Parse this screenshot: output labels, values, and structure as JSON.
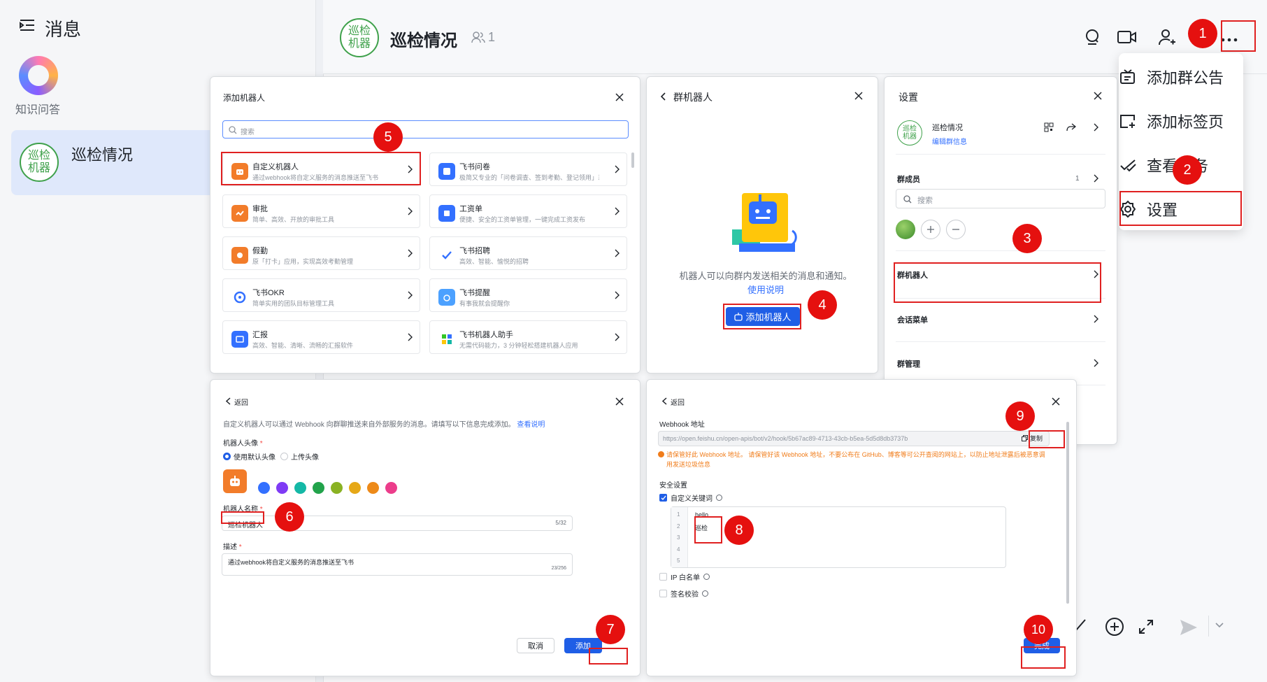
{
  "sidebar": {
    "title": "消息",
    "app_label": "知识问答",
    "conversation": {
      "name": "巡检情况",
      "avatar_text": "巡检机器"
    }
  },
  "header": {
    "avatar_text": "巡检机器",
    "title": "巡检情况",
    "member_count": "1"
  },
  "dropdown_menu": {
    "items": [
      {
        "label": "添加群公告",
        "icon": "announcement-icon"
      },
      {
        "label": "添加标签页",
        "icon": "add-tab-icon"
      },
      {
        "label": "查看任务",
        "icon": "task-check-icon"
      },
      {
        "label": "设置",
        "icon": "gear-icon"
      }
    ]
  },
  "add_robot_panel": {
    "title": "添加机器人",
    "search_placeholder": "搜索",
    "cards": [
      {
        "title": "自定义机器人",
        "desc": "通过webhook将自定义服务的消息推送至飞书",
        "color": "#f27c2a"
      },
      {
        "title": "飞书问卷",
        "desc": "极简又专业的「问卷调查、签到考勤、登记领用」系统",
        "color": "#3370ff"
      },
      {
        "title": "审批",
        "desc": "简单、高效、开放的审批工具",
        "color": "#f27c2a"
      },
      {
        "title": "工资单",
        "desc": "便捷、安全的工资单管理，一键完成工资发布",
        "color": "#3370ff"
      },
      {
        "title": "假勤",
        "desc": "原「打卡」应用，实现高效考勤管理",
        "color": "#f27c2a"
      },
      {
        "title": "飞书招聘",
        "desc": "高效、智能、愉悦的招聘",
        "color": "#3370ff"
      },
      {
        "title": "飞书OKR",
        "desc": "简单实用的团队目标管理工具",
        "color": "#3370ff"
      },
      {
        "title": "飞书提醒",
        "desc": "有事我就会提醒你",
        "color": "#4ca1ff"
      },
      {
        "title": "汇报",
        "desc": "高效、智能、清晰、流畅的汇报软件",
        "color": "#3370ff"
      },
      {
        "title": "飞书机器人助手",
        "desc": "无需代码能力，3 分钟轻松搭建机器人应用",
        "color": "#34c724"
      }
    ]
  },
  "group_robot_panel": {
    "title": "群机器人",
    "description": "机器人可以向群内发送相关的消息和通知。",
    "help_link": "使用说明",
    "add_button": "添加机器人"
  },
  "settings_panel": {
    "title": "设置",
    "group_name": "巡检情况",
    "edit_info": "编辑群信息",
    "members_label": "群成员",
    "members_count": "1",
    "search_placeholder": "搜索",
    "group_robot": "群机器人",
    "session_menu": "会话菜单",
    "group_manage": "群管理"
  },
  "custom_robot_form": {
    "back": "返回",
    "intro": "自定义机器人可以通过 Webhook 向群聊推送来自外部服务的消息。请填写以下信息完成添加。",
    "intro_link": "查看说明",
    "avatar_label": "机器人头像",
    "avatar_default": "使用默认头像",
    "avatar_upload": "上传头像",
    "avatar_colors": [
      "#3370ff",
      "#7f3bf5",
      "#14b8a6",
      "#22a34b",
      "#8ab223",
      "#e6a817",
      "#ed8a19",
      "#ec3d8b"
    ],
    "name_label": "机器人名称",
    "name_value": "巡检机器人",
    "name_counter": "5/32",
    "desc_label": "描述",
    "desc_value": "通过webhook将自定义服务的消息推送至飞书",
    "desc_counter": "23/256",
    "cancel": "取消",
    "add": "添加"
  },
  "webhook_panel": {
    "back": "返回",
    "webhook_label": "Webhook 地址",
    "webhook_url": "https://open.feishu.cn/open-apis/bot/v2/hook/5b67ac89-4713-43cb-b5ea-5d5d8db3737b",
    "copy": "复制",
    "warning": "请保管好此 Webhook 地址。 请保管好该 Webhook 地址，不要公布在 GitHub、博客等可公开查阅的网站上，以防止地址泄露后被恶意调用发送垃圾信息",
    "security_label": "安全设置",
    "keyword_label": "自定义关键词",
    "keywords": [
      "hello",
      "巡检",
      "",
      "",
      ""
    ],
    "ip_whitelist": "IP 白名单",
    "signature": "签名校验",
    "done": "完成"
  },
  "steps": [
    "1",
    "2",
    "3",
    "4",
    "5",
    "6",
    "7",
    "8",
    "9",
    "10"
  ],
  "colors": {
    "accent": "#1f5ee6",
    "annotation": "#e02020",
    "brand_green": "#3fa14b"
  }
}
